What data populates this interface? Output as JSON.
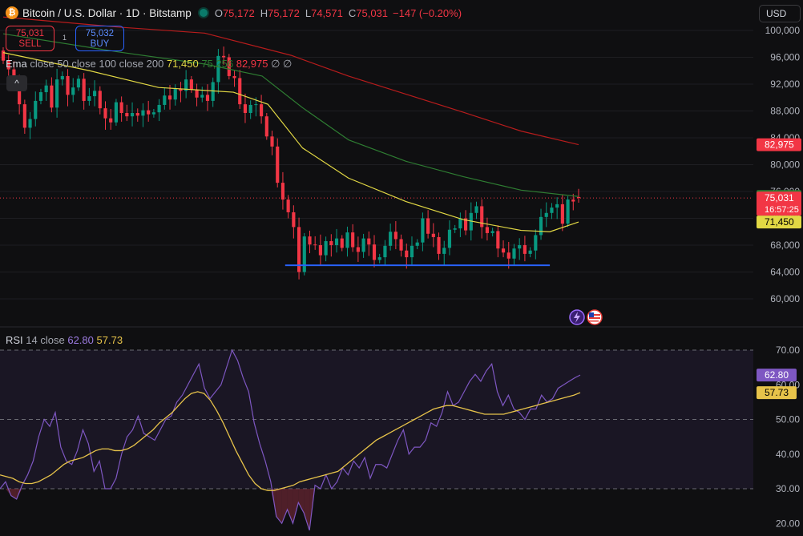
{
  "header": {
    "symbol": "Bitcoin / U.S. Dollar · 1D · Bitstamp",
    "logo_glyph": "₿",
    "o_label": "O",
    "o_value": "75,172",
    "h_label": "H",
    "h_value": "75,172",
    "l_label": "L",
    "l_value": "74,571",
    "c_label": "C",
    "c_value": "75,031",
    "change": "−147 (−0.20%)",
    "currency": "USD"
  },
  "trade": {
    "sell_price": "75,031",
    "sell_label": "SELL",
    "buy_price": "75,032",
    "buy_label": "BUY",
    "spread": "1"
  },
  "ema_legend": {
    "name": "Ema",
    "params": "close 50 close 100 close 200",
    "v1": "71,450",
    "v2": "75,256",
    "v3": "82,975",
    "hide_glyphs": "∅ ∅"
  },
  "collapse_glyph": "^",
  "rsi_legend": {
    "name": "RSI",
    "params": "14 close",
    "rsi": "62.80",
    "ma": "57.73"
  },
  "colors": {
    "up": "#089981",
    "down": "#f23645",
    "ema50": "#e2d844",
    "ema100": "#2e7d32",
    "ema200": "#b71c1c",
    "support": "#2962ff",
    "rsi": "#7e57c2",
    "rsi_ma": "#e7c34a"
  },
  "icons": [
    "lightning-icon",
    "us-flag-icon"
  ],
  "chart_data": [
    {
      "type": "candlestick",
      "title": "Bitcoin / U.S. Dollar · 1D · Bitstamp",
      "ylim": [
        58000,
        101000
      ],
      "y_ticks": [
        "100,000",
        "96,000",
        "92,000",
        "88,000",
        "84,000",
        "80,000",
        "76,000",
        "72,000",
        "68,000",
        "64,000",
        "60,000"
      ],
      "last_close": 75031,
      "countdown": "16:57:25",
      "price_labels": [
        {
          "label": "82,975",
          "value": 82975,
          "color": "#f23645"
        },
        {
          "label": "75,256",
          "value": 75256,
          "color": "#2e7d32"
        },
        {
          "label": "75,031",
          "value": 75031,
          "color": "#f23645"
        },
        {
          "label": "71,450",
          "value": 71450,
          "color": "#e2d844"
        }
      ],
      "support_level": 65000,
      "support_range": [
        49,
        95
      ],
      "series": [
        {
          "name": "EMA 50",
          "style": "line",
          "values": [
            [
              0,
              96700
            ],
            [
              15,
              94000
            ],
            [
              27,
              91500
            ],
            [
              40,
              90800
            ],
            [
              46,
              89000
            ],
            [
              52,
              82500
            ],
            [
              60,
              78000
            ],
            [
              70,
              74500
            ],
            [
              80,
              71800
            ],
            [
              90,
              70200
            ],
            [
              95,
              70000
            ],
            [
              100,
              71450
            ]
          ]
        },
        {
          "name": "EMA 100",
          "style": "line",
          "values": [
            [
              0,
              99500
            ],
            [
              20,
              96800
            ],
            [
              35,
              95000
            ],
            [
              45,
              93200
            ],
            [
              52,
              88500
            ],
            [
              60,
              83700
            ],
            [
              70,
              80500
            ],
            [
              80,
              78200
            ],
            [
              90,
              76200
            ],
            [
              100,
              75256
            ]
          ]
        },
        {
          "name": "EMA 200",
          "style": "line",
          "values": [
            [
              0,
              102000
            ],
            [
              20,
              100500
            ],
            [
              35,
              99600
            ],
            [
              50,
              96300
            ],
            [
              60,
              93200
            ],
            [
              70,
              90500
            ],
            [
              80,
              87800
            ],
            [
              90,
              85000
            ],
            [
              100,
              82975
            ]
          ]
        }
      ],
      "candles_close": [
        95500,
        94200,
        91800,
        89000,
        85500,
        86800,
        89500,
        90800,
        91800,
        88500,
        92700,
        93200,
        90400,
        91500,
        92800,
        89500,
        90200,
        91000,
        88400,
        86900,
        86300,
        89300,
        87700,
        87200,
        87700,
        87300,
        88100,
        87500,
        87800,
        88900,
        90300,
        89700,
        91300,
        91000,
        92700,
        91200,
        90000,
        90400,
        89500,
        92300,
        96200,
        96000,
        93200,
        92900,
        89000,
        87700,
        88900,
        89000,
        87200,
        84200,
        82700,
        77300,
        74800,
        72900,
        70700,
        64000,
        69300,
        68100,
        68000,
        66500,
        68600,
        68000,
        69000,
        67600,
        69900,
        67700,
        67000,
        69000,
        68100,
        65800,
        66200,
        67900,
        70000,
        68900,
        67200,
        66200,
        67900,
        68400,
        72000,
        69700,
        69200,
        66700,
        67600,
        70300,
        70500,
        72000,
        70200,
        72800,
        73800,
        70700,
        69800,
        70100,
        67500,
        66900,
        66000,
        67500,
        68000,
        66700,
        67200,
        69500,
        72200,
        72800,
        73600,
        74100,
        71200,
        74800,
        74500,
        75031
      ],
      "candles_open": [
        97000,
        95500,
        94200,
        91800,
        89000,
        85500,
        86800,
        89500,
        90800,
        91800,
        88500,
        92700,
        93200,
        90400,
        91500,
        92800,
        89500,
        90200,
        91000,
        88400,
        86900,
        86300,
        89300,
        87700,
        87200,
        87700,
        87300,
        88100,
        87500,
        87800,
        88900,
        90300,
        89700,
        91300,
        91000,
        92700,
        91200,
        90000,
        90400,
        89500,
        92300,
        96200,
        96000,
        93200,
        92900,
        89000,
        87700,
        88900,
        89000,
        87200,
        84200,
        82700,
        77300,
        74800,
        72900,
        70700,
        64000,
        69300,
        68100,
        68000,
        66500,
        68600,
        68000,
        69000,
        67600,
        69900,
        67700,
        67000,
        69000,
        68100,
        65800,
        66200,
        67900,
        70000,
        68900,
        67200,
        66200,
        67900,
        68400,
        72000,
        69700,
        69200,
        66700,
        67600,
        70300,
        70500,
        72000,
        70200,
        72800,
        73800,
        70700,
        69800,
        70100,
        67500,
        66900,
        66000,
        67500,
        68000,
        66700,
        67200,
        69500,
        72200,
        72800,
        73600,
        74100,
        71200,
        74800,
        75172
      ]
    },
    {
      "type": "line",
      "title": "RSI 14 close",
      "ylim": [
        18,
        72
      ],
      "y_ticks": [
        "70.00",
        "60.00",
        "50.00",
        "40.00",
        "30.00",
        "20.00"
      ],
      "bands": [
        70,
        50,
        30
      ],
      "series": [
        {
          "name": "RSI",
          "values": [
            30,
            32,
            28,
            27,
            31,
            34,
            38,
            45,
            50,
            48,
            52,
            42,
            38,
            37,
            41,
            47,
            43,
            35,
            38,
            30,
            30,
            33,
            40,
            45,
            47,
            51,
            46,
            45,
            44,
            47,
            50,
            51,
            55,
            57,
            60,
            63,
            66,
            59,
            56,
            58,
            60,
            65,
            70,
            67,
            62,
            58,
            49,
            43,
            38,
            32,
            22,
            20,
            24,
            20,
            26,
            23,
            18,
            31,
            30,
            34,
            30,
            32,
            36,
            34,
            38,
            36,
            39,
            33,
            37,
            37,
            36,
            40,
            44,
            47,
            40,
            42,
            42,
            44,
            49,
            48,
            52,
            58,
            54,
            55,
            58,
            61,
            63,
            61,
            64,
            66,
            58,
            54,
            57,
            53,
            52,
            50,
            53,
            53,
            57,
            55,
            56,
            59,
            60,
            61,
            62,
            62.8
          ]
        },
        {
          "name": "RSI MA",
          "values": [
            34,
            33.5,
            33,
            32,
            31.5,
            31.5,
            32,
            33,
            34,
            35.5,
            37,
            38,
            38.5,
            39,
            40,
            41,
            41.5,
            41.5,
            41,
            41,
            41.5,
            42.5,
            44,
            45.5,
            47,
            49,
            50.5,
            52,
            54,
            56,
            57.5,
            58,
            57.5,
            55.5,
            52.5,
            49,
            45,
            41,
            37.5,
            34,
            31.5,
            30,
            29.5,
            29.5,
            30,
            30.5,
            31,
            32,
            32.5,
            33,
            33.5,
            34,
            34.5,
            35,
            36.5,
            38,
            39.5,
            41,
            42.5,
            44,
            45,
            46,
            47,
            48,
            49,
            50,
            51,
            52,
            53,
            53.5,
            54,
            54,
            53.5,
            53,
            52.5,
            52,
            51.5,
            51.5,
            51.5,
            51.5,
            52,
            52.5,
            53,
            53.5,
            54,
            54.5,
            55,
            55.5,
            56,
            56.5,
            57,
            57.73
          ]
        }
      ],
      "price_labels": [
        {
          "label": "62.80",
          "value": 62.8,
          "color": "#7e57c2"
        },
        {
          "label": "57.73",
          "value": 57.73,
          "color": "#e7c34a"
        }
      ]
    }
  ]
}
